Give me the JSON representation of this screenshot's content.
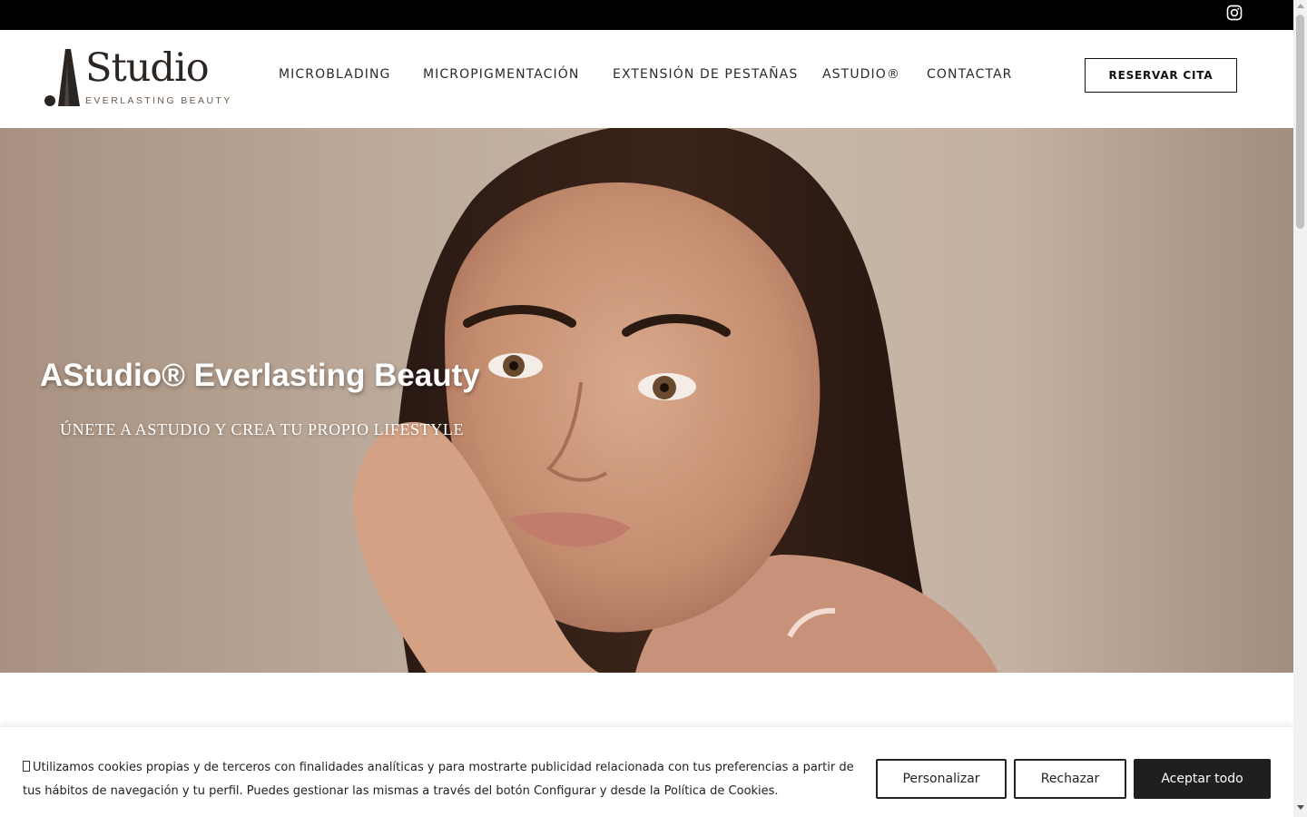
{
  "topbar": {
    "social_icon": "instagram-icon"
  },
  "logo": {
    "word": "Studio",
    "tagline": "EVERLASTING BEAUTY"
  },
  "nav": {
    "items": [
      {
        "label": "MICROBLADING"
      },
      {
        "label": "MICROPIGMENTACIÓN"
      },
      {
        "label": "EXTENSIÓN DE PESTAÑAS"
      },
      {
        "label": "ASTUDIO®"
      },
      {
        "label": "CONTACTAR"
      }
    ],
    "cta_label": "RESERVAR CITA"
  },
  "hero": {
    "title": "AStudio® Everlasting Beauty",
    "subtitle": "ÚNETE A ASTUDIO Y CREA TU PROPIO LIFESTYLE",
    "image": "woman-portrait-hand-on-cheek"
  },
  "cookie_banner": {
    "text": "Utilizamos cookies propias y de terceros con finalidades analíticas y para mostrarte publicidad relacionada con tus preferencias a partir de tus hábitos de navegación y tu perfil. Puedes gestionar las mismas a través del botón Configurar y desde la Política de Cookies.",
    "customize_label": "Personalizar",
    "reject_label": "Rechazar",
    "accept_label": "Aceptar todo"
  },
  "colors": {
    "topbar": "#000000",
    "accent_dark": "#1f1f1f",
    "hero_bg": "#c3b0a0",
    "logo_brown": "#2c2623"
  }
}
